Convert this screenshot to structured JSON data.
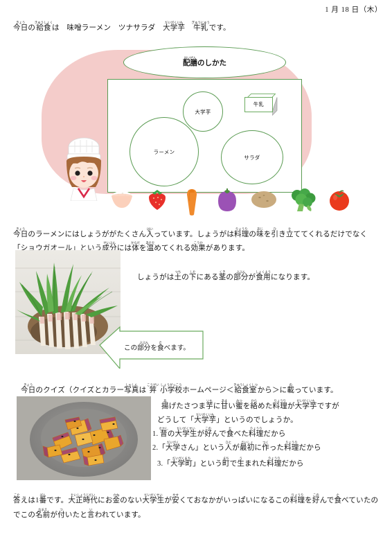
{
  "document": {
    "date": "1 月 18 日（木）",
    "menu_line": {
      "segments": [
        {
          "base": "今日",
          "ruby": "きょう"
        },
        {
          "base": "の",
          "ruby": ""
        },
        {
          "base": "給食",
          "ruby": "きゅうしょく"
        },
        {
          "base": "は　味噌ラーメン　ツナサラダ　",
          "ruby": ""
        },
        {
          "base": "大学芋",
          "ruby": "だいがくいも"
        },
        {
          "base": "　",
          "ruby": ""
        },
        {
          "base": "牛乳",
          "ruby": "ぎゅうにゅう"
        },
        {
          "base": "です。",
          "ruby": ""
        }
      ],
      "plain": "今日の給食は　味噌ラーメン　ツナサラダ　大学芋　牛乳です。"
    }
  },
  "serving_diagram": {
    "title": {
      "base": "配膳",
      "ruby": "はいぜん",
      "suffix": "のしかた"
    },
    "title_plain": "配膳のしかた",
    "dishes": [
      {
        "name": "ramen",
        "label": "ラーメン"
      },
      {
        "name": "daigakuimo",
        "label": "大学芋"
      },
      {
        "name": "salad",
        "label": "サラダ"
      },
      {
        "name": "milk",
        "label": "牛乳"
      }
    ],
    "food_icons": [
      "rice-bowl",
      "strawberry",
      "carrot",
      "eggplant",
      "potato",
      "broccoli",
      "tomato"
    ],
    "character": "chef-girl"
  },
  "ginger_section": {
    "paragraph_1": "今日のラーメンにはしょうががたくさん入っています。しょうがは料理の味を引き立ててくれるだけでなく",
    "paragraph_2": "「ショウガオール」という成分には体を温めてくれる効果があります。",
    "side_note": "しょうがは土の下にある茎の部分が食用になります。",
    "callout": "この部分を食べます。",
    "photo_caption": "ginger-plant-photo"
  },
  "quiz_section": {
    "intro": "今日のクイズ（クイズとカラー写真は 笄 小学校ホームページ＜給食室から＞に載っています。",
    "question_line_1": "揚げたさつま芋に甘い蜜を絡めた料理が大学芋ですが",
    "question_line_2": "どうして「大学芋」というのでしょうか。",
    "options": [
      "1. 昔の大学生が好んで食べた料理だから",
      "2.「大学さん」という人が最初に作った料理だから",
      "3.「大学町」という町で生まれた料理だから"
    ],
    "photo_caption": "daigakuimo-photo"
  },
  "answer_section": {
    "line_1": "答えは1番です。大正時代にお金のない大学生が安くておなかがいっぱいになるこの料理を好んで食べていたの",
    "line_2": "でこの名前が付いたと言われています。"
  },
  "colors": {
    "pink_blob": "#f4ccca",
    "green_outline": "#5a9b52",
    "text": "#1a1a1a",
    "milk_side": "#c9c9c9"
  }
}
